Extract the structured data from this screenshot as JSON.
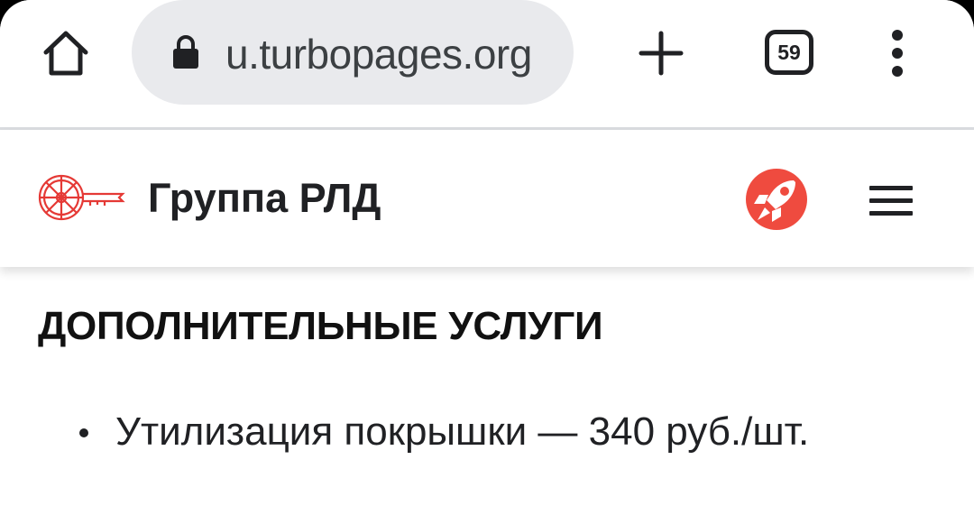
{
  "browser": {
    "url": "u.turbopages.org",
    "tab_count": "59",
    "icons": {
      "home": "home-icon",
      "lock": "lock-icon",
      "new_tab": "plus-icon",
      "menu": "more-vert-icon"
    }
  },
  "site": {
    "title": "Группа РЛД",
    "logo_color": "#e53935",
    "badge_color": "#ef4b3f"
  },
  "main": {
    "heading": "ДОПОЛНИТЕЛЬНЫЕ УСЛУГИ",
    "services": [
      {
        "text": "Утилизация покрышки — 340 руб./шт."
      }
    ]
  }
}
